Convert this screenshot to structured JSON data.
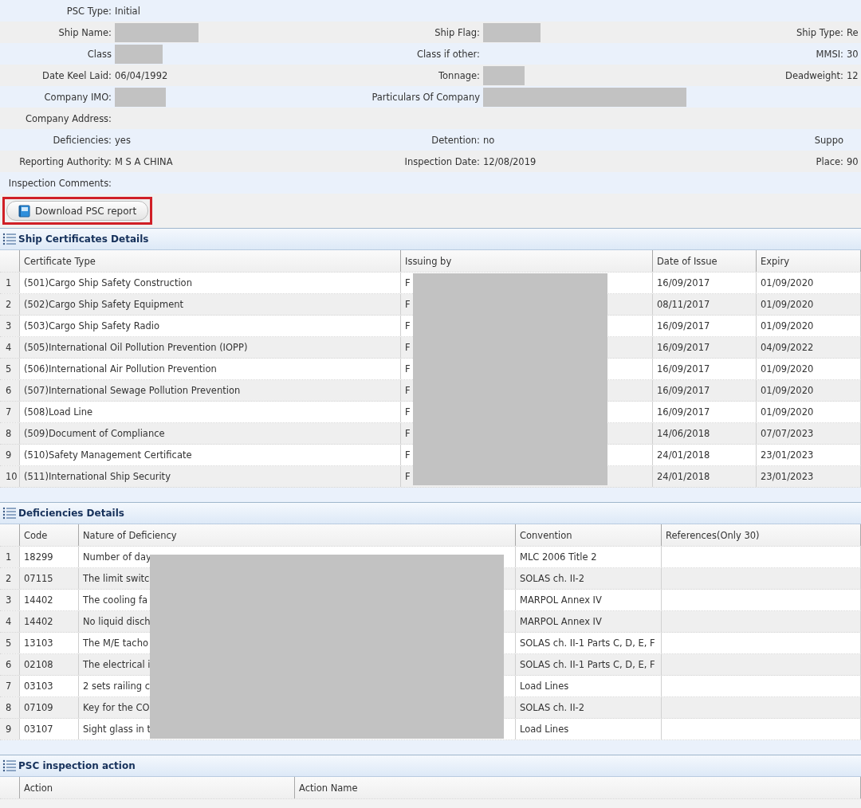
{
  "info_rows": [
    [
      {
        "label": "PSC Type:",
        "value": "Initial"
      }
    ],
    [
      {
        "label": "Ship Name:",
        "redacted": true
      },
      {
        "label": "Ship Flag:",
        "redacted": true
      },
      {
        "label": "Ship Type:",
        "value": "Re"
      }
    ],
    [
      {
        "label": "Class",
        "redacted": true
      },
      {
        "label": "Class if other:"
      },
      {
        "label": "MMSI:",
        "value": "30"
      }
    ],
    [
      {
        "label": "Date Keel Laid:",
        "value": "06/04/1992"
      },
      {
        "label": "Tonnage:",
        "redacted": true
      },
      {
        "label": "Deadweight:",
        "value": "12"
      }
    ],
    [
      {
        "label": "Company IMO:",
        "redacted": true
      },
      {
        "label": "Particulars Of Company",
        "redacted": true
      }
    ],
    [
      {
        "label": "Company Address:"
      }
    ],
    [
      {
        "label": "Deficiencies:",
        "value": "yes"
      },
      {
        "label": "Detention:",
        "value": "no"
      },
      {
        "label": "Suppo"
      }
    ],
    [
      {
        "label": "Reporting Authority:",
        "value": "M S A CHINA"
      },
      {
        "label": "Inspection Date:",
        "value": "12/08/2019"
      },
      {
        "label": "Place:",
        "value": "90"
      }
    ],
    [
      {
        "label": "Inspection Comments:"
      }
    ]
  ],
  "download_button": {
    "label": "Download PSC report",
    "highlighted": true
  },
  "sections": [
    {
      "kind": "certificates",
      "title": "Ship Certificates Details",
      "redacted": true,
      "columns": [
        "Certificate Type",
        "Issuing by",
        "Date of Issue",
        "Expiry"
      ],
      "rows": [
        {
          "number": "1",
          "cells": [
            "(501)Cargo Ship Safety Construction",
            "F",
            "16/09/2017",
            "01/09/2020"
          ]
        },
        {
          "number": "2",
          "cells": [
            "(502)Cargo Ship Safety Equipment",
            "F",
            "08/11/2017",
            "01/09/2020"
          ]
        },
        {
          "number": "3",
          "cells": [
            "(503)Cargo Ship Safety Radio",
            "F",
            "16/09/2017",
            "01/09/2020"
          ]
        },
        {
          "number": "4",
          "cells": [
            "(505)International Oil Pollution Prevention (IOPP)",
            "F",
            "16/09/2017",
            "04/09/2022"
          ]
        },
        {
          "number": "5",
          "cells": [
            "(506)International Air Pollution Prevention",
            "F",
            "16/09/2017",
            "01/09/2020"
          ]
        },
        {
          "number": "6",
          "cells": [
            "(507)International Sewage Pollution Prevention",
            "F",
            "16/09/2017",
            "01/09/2020"
          ]
        },
        {
          "number": "7",
          "cells": [
            "(508)Load Line",
            "F",
            "16/09/2017",
            "01/09/2020"
          ]
        },
        {
          "number": "8",
          "cells": [
            "(509)Document of Compliance",
            "F",
            "14/06/2018",
            "07/07/2023"
          ]
        },
        {
          "number": "9",
          "cells": [
            "(510)Safety Management Certificate",
            "F",
            "24/01/2018",
            "23/01/2023"
          ]
        },
        {
          "number": "10",
          "cells": [
            "(511)International Ship Security",
            "F",
            "24/01/2018",
            "23/01/2023"
          ]
        }
      ]
    },
    {
      "kind": "deficiencies",
      "title": "Deficiencies Details",
      "redacted": true,
      "columns": [
        "Code",
        "Nature of Deficiency",
        "Convention",
        "References(Only 30)"
      ],
      "rows": [
        {
          "number": "1",
          "cells": [
            "18299",
            "Number of day",
            "MLC 2006 Title 2",
            ""
          ]
        },
        {
          "number": "2",
          "cells": [
            "07115",
            "The limit switc",
            "SOLAS ch. II-2",
            ""
          ]
        },
        {
          "number": "3",
          "cells": [
            "14402",
            "The cooling fa",
            "MARPOL Annex IV",
            ""
          ]
        },
        {
          "number": "4",
          "cells": [
            "14402",
            "No liquid disch",
            "MARPOL Annex IV",
            ""
          ]
        },
        {
          "number": "5",
          "cells": [
            "13103",
            "The M/E tacho",
            "SOLAS ch. II-1 Parts C, D, E, F",
            ""
          ]
        },
        {
          "number": "6",
          "cells": [
            "02108",
            "The electrical i",
            "SOLAS ch. II-1 Parts C, D, E, F",
            ""
          ]
        },
        {
          "number": "7",
          "cells": [
            "03103",
            "2 sets railing c",
            "Load Lines",
            ""
          ]
        },
        {
          "number": "8",
          "cells": [
            "07109",
            "Key for the CO",
            "SOLAS ch. II-2",
            ""
          ]
        },
        {
          "number": "9",
          "cells": [
            "03107",
            "Sight glass in t",
            "Load Lines",
            ""
          ]
        }
      ]
    },
    {
      "kind": "actions",
      "title": "PSC inspection action",
      "columns": [
        "Action",
        "Action Name"
      ]
    }
  ]
}
